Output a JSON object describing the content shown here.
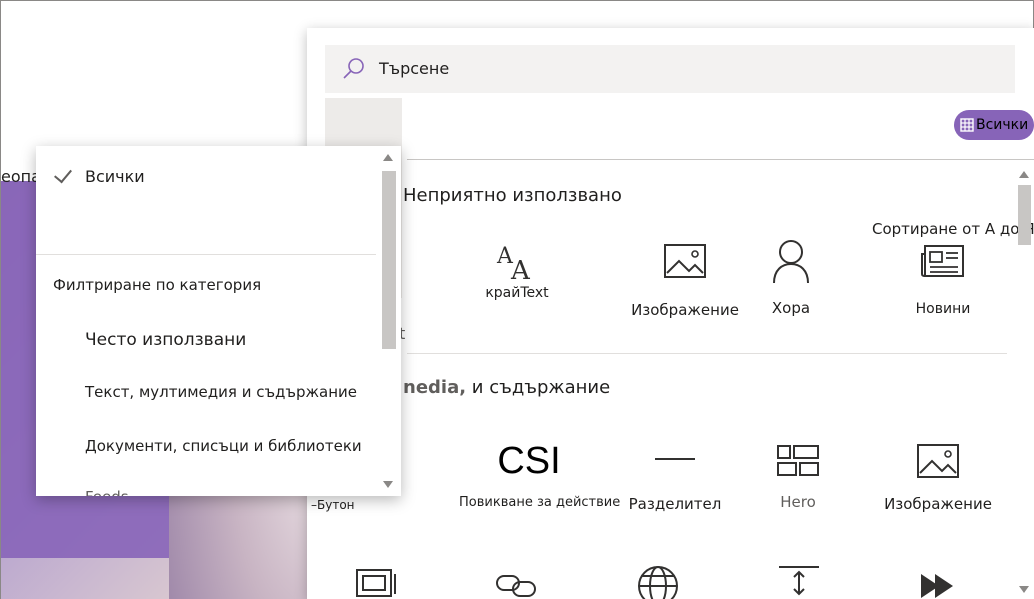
{
  "background": {
    "tail_text": "еопашка"
  },
  "toolbox": {
    "search_text": "Търсене",
    "view_label": "Всички",
    "sections": {
      "frequent": "Неприятно използвано",
      "media_partial": "nedia,",
      "media_rest": "и съдържание"
    },
    "sort_label": "Сортиране от А до Я",
    "frequent_tiles": [
      {
        "label": "крайText",
        "icon": "text-icon"
      },
      {
        "label": "Изображение",
        "icon": "image-icon"
      },
      {
        "label": "Хора",
        "icon": "people-icon"
      },
      {
        "label": "Новини",
        "icon": "news-icon"
      }
    ],
    "media_tiles": [
      {
        "label": "Повикване за действие",
        "icon": "csi-icon",
        "glyph": "CSI"
      },
      {
        "label": "Разделител",
        "icon": "divider-icon"
      },
      {
        "label": "Hero",
        "icon": "hero-icon"
      },
      {
        "label": "Изображение",
        "icon": "image-icon"
      }
    ],
    "left_clipped_text": "t",
    "button_label": "–Бутон"
  },
  "filter": {
    "selected": "Всички",
    "heading": "Филтриране по категория",
    "items": [
      "Често използвани",
      "Текст, мултимедия и съдържание",
      "Документи, списъци и библиотеки",
      "Feeds"
    ]
  }
}
